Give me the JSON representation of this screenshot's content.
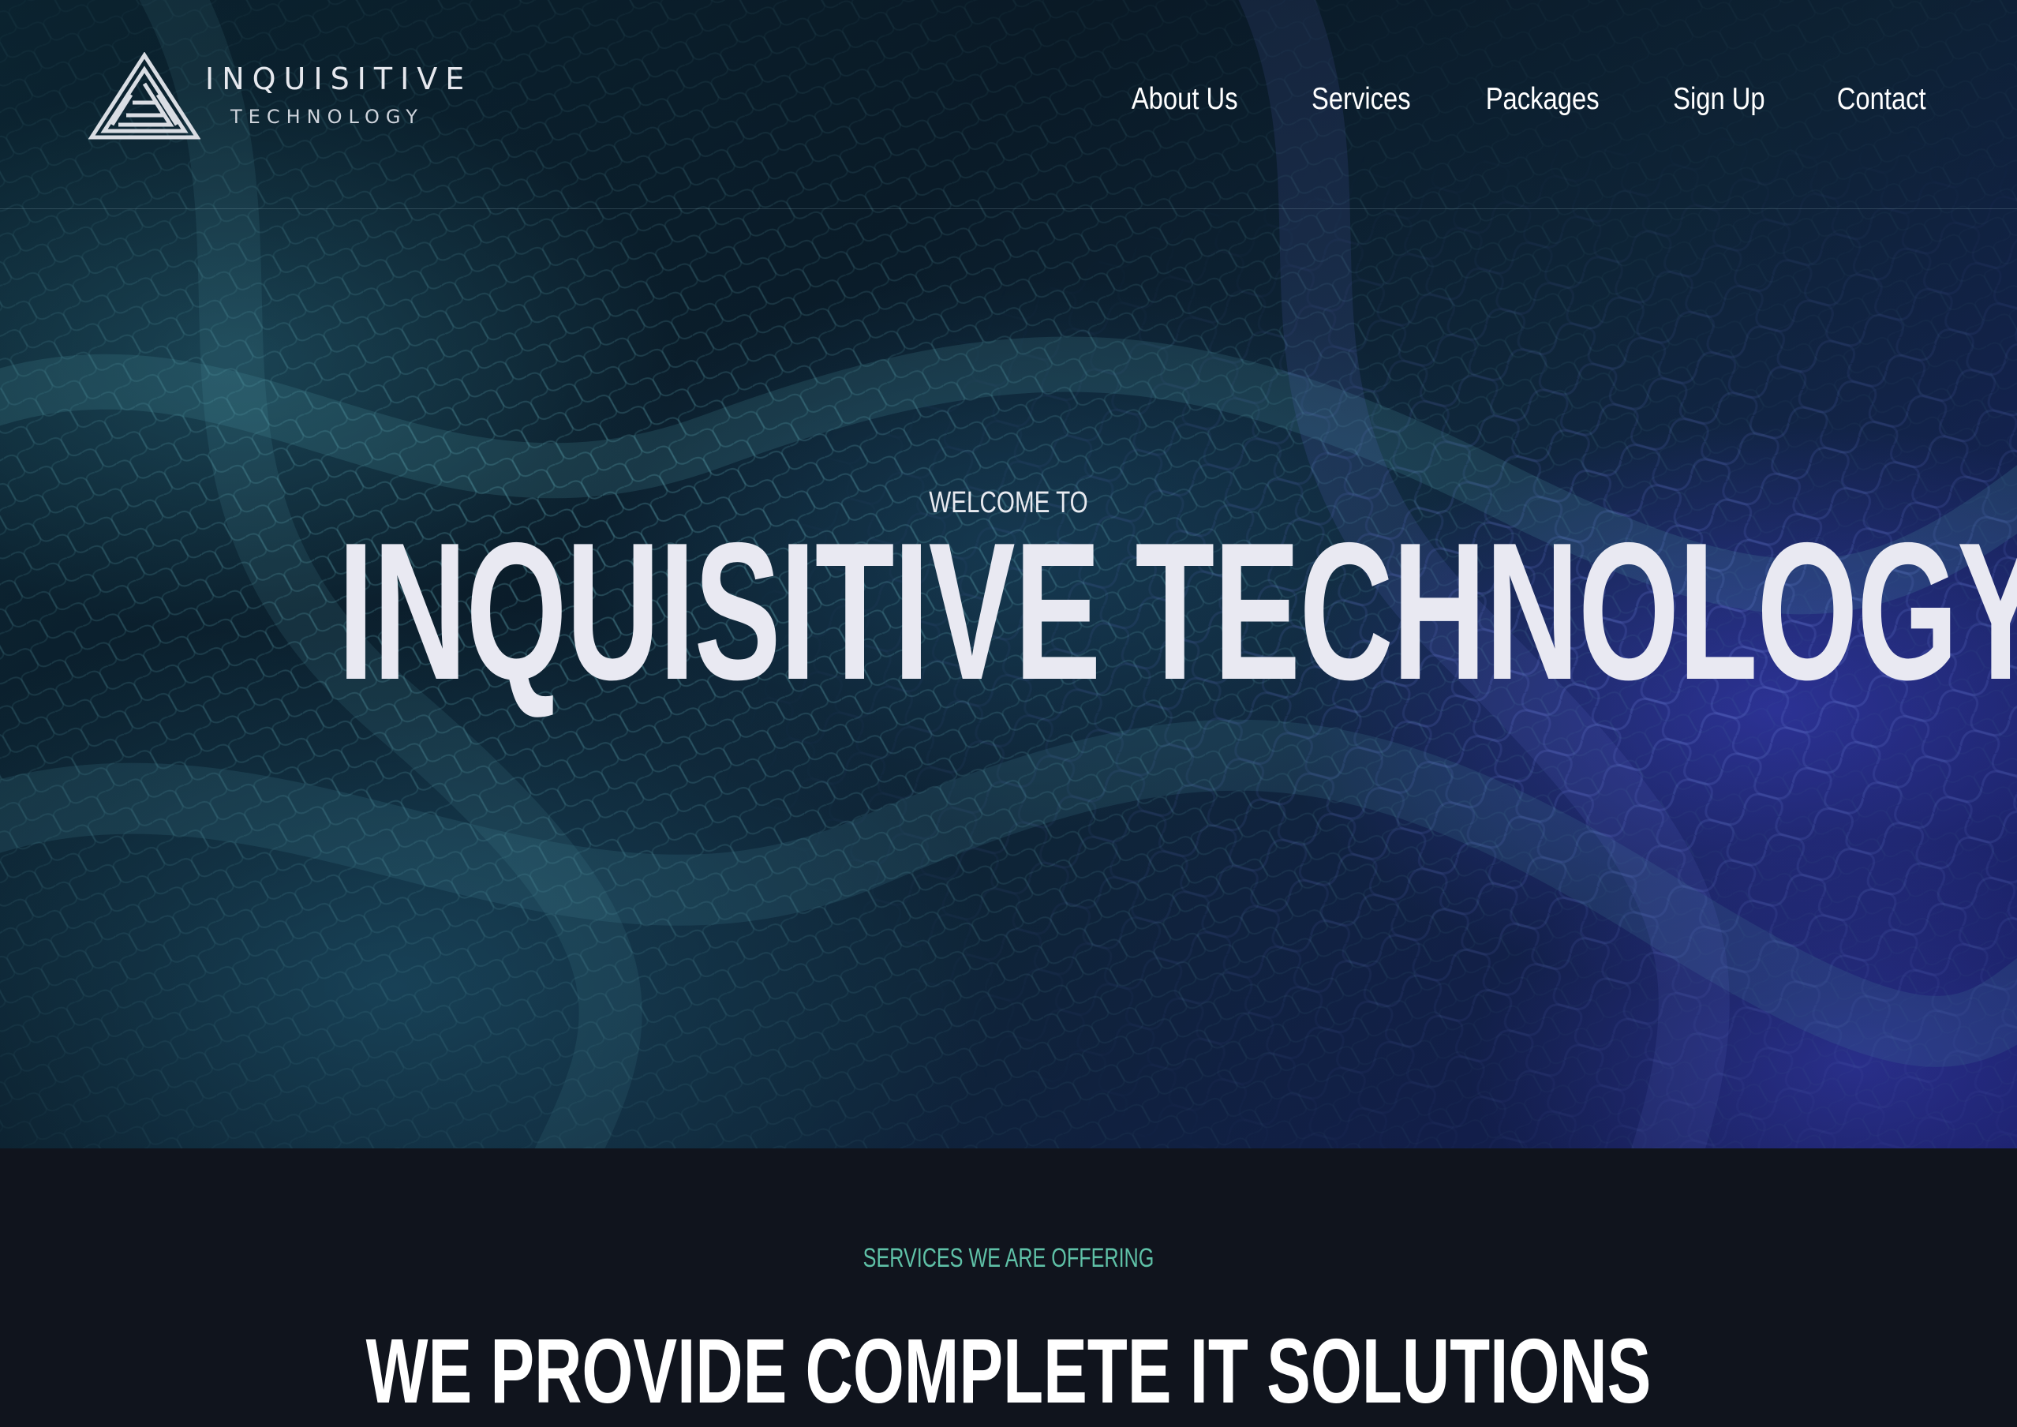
{
  "brand": {
    "name_line1": "INQUISITIVE",
    "name_line2": "TECHNOLOGY",
    "logo_icon": "triangle-maze-logo-icon"
  },
  "nav": {
    "items": [
      {
        "label": "About Us"
      },
      {
        "label": "Services"
      },
      {
        "label": "Packages"
      },
      {
        "label": "Sign Up"
      },
      {
        "label": "Contact"
      }
    ]
  },
  "hero": {
    "eyebrow": "WELCOME TO",
    "title": "INQUISITIVE TECHNOLOGY"
  },
  "services": {
    "eyebrow": "SERVICES WE ARE OFFERING",
    "heading": "WE PROVIDE COMPLETE IT SOLUTIONS"
  },
  "colors": {
    "accent": "#5fc1a7",
    "section_background": "#10141d",
    "hero_text": "#e9e9f2"
  }
}
